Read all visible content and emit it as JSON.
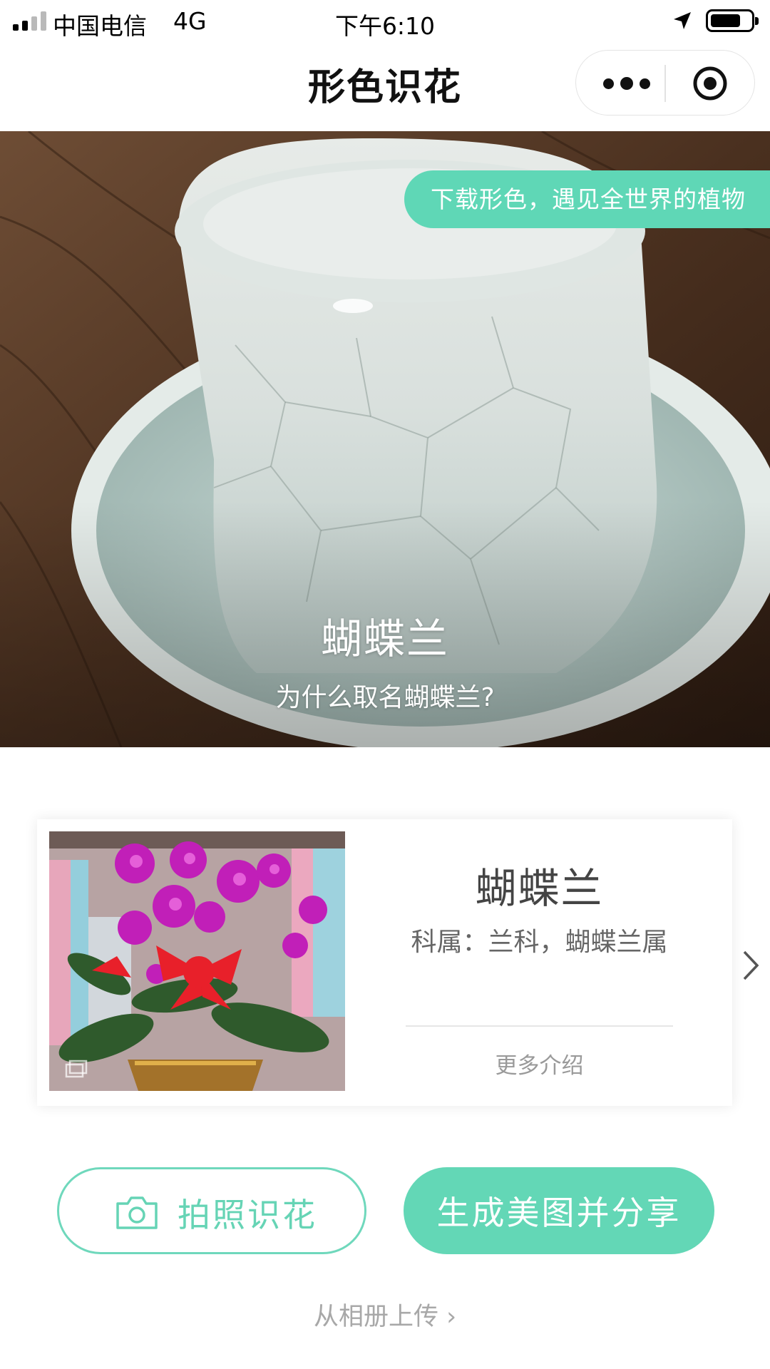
{
  "status_bar": {
    "carrier": "中国电信",
    "network": "4G",
    "time": "下午6:10",
    "battery_level": 0.75
  },
  "nav": {
    "title": "形色识花",
    "more_icon": "more-dots-icon",
    "close_icon": "target-circle-icon"
  },
  "hero": {
    "tag": "下载形色，遇见全世界的植物",
    "title": "蝴蝶兰",
    "subtitle": "为什么取名蝴蝶兰?"
  },
  "result_card": {
    "name": "蝴蝶兰",
    "family": "科属：兰科，蝴蝶兰属",
    "more": "更多介绍"
  },
  "actions": {
    "take_photo": "拍照识花",
    "share": "生成美图并分享",
    "upload": "从相册上传 ›"
  },
  "colors": {
    "accent": "#63d7b6",
    "accent_text": "#66d4b5"
  }
}
